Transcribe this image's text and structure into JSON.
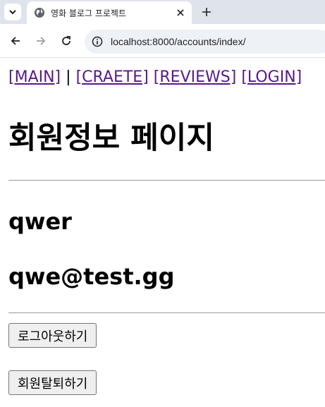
{
  "browser": {
    "tab": {
      "title": "영화 블로그 프로젝트",
      "favicon": "globe-icon"
    },
    "icons": {
      "tab_list": "chevron-down-icon",
      "close": "close-icon",
      "new_tab": "plus-icon",
      "back": "back-arrow-icon",
      "forward": "forward-arrow-icon",
      "reload": "reload-icon",
      "site_info": "info-icon"
    },
    "url": "localhost:8000/accounts/index/"
  },
  "nav": {
    "main": "[MAIN]",
    "separator": "|",
    "create": "[CRAETE]",
    "reviews": "[REVIEWS]",
    "login": "[LOGIN]"
  },
  "page": {
    "title": "회원정보 페이지",
    "username": "qwer",
    "email": "qwe@test.gg"
  },
  "buttons": {
    "logout": "로그아웃하기",
    "withdraw": "회원탈퇴하기"
  },
  "colors": {
    "link": "#551a8b",
    "tabstrip": "#dfe3eb",
    "omnibox": "#eef1f6"
  }
}
